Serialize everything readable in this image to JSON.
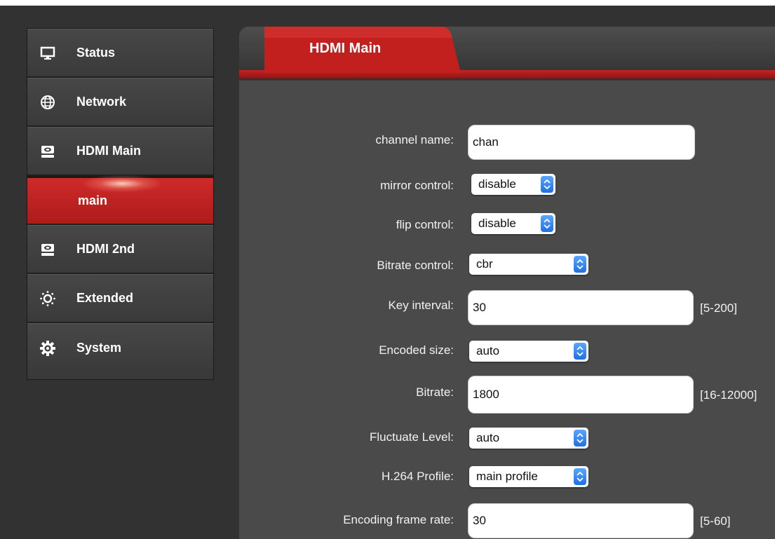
{
  "sidebar": {
    "items": [
      {
        "label": "Status",
        "icon": "monitor-icon"
      },
      {
        "label": "Network",
        "icon": "globe-icon"
      },
      {
        "label": "HDMI Main",
        "icon": "hdmi-device-icon"
      },
      {
        "label": "main",
        "icon": ""
      },
      {
        "label": "HDMI 2nd",
        "icon": "hdmi-device-icon"
      },
      {
        "label": "Extended",
        "icon": "dotted-gear-icon"
      },
      {
        "label": "System",
        "icon": "gear-icon"
      }
    ]
  },
  "tab": {
    "label": "HDMI Main"
  },
  "form": {
    "channel_name": {
      "label": "channel name:",
      "value": "chan"
    },
    "mirror_control": {
      "label": "mirror control:",
      "value": "disable"
    },
    "flip_control": {
      "label": "flip control:",
      "value": "disable"
    },
    "bitrate_control": {
      "label": "Bitrate control:",
      "value": "cbr"
    },
    "key_interval": {
      "label": "Key interval:",
      "value": "30",
      "range": "[5-200]"
    },
    "encoded_size": {
      "label": "Encoded size:",
      "value": "auto"
    },
    "bitrate": {
      "label": "Bitrate:",
      "value": "1800",
      "range": "[16-12000]"
    },
    "fluctuate_level": {
      "label": "Fluctuate Level:",
      "value": "auto"
    },
    "h264_profile": {
      "label": "H.264 Profile:",
      "value": "main profile"
    },
    "frame_rate": {
      "label": "Encoding frame rate:",
      "value": "30",
      "range": "[5-60]"
    }
  },
  "colors": {
    "accent_red": "#c62222",
    "select_arrow": "#1f6fe6",
    "panel_bg": "#4a4a4a"
  }
}
